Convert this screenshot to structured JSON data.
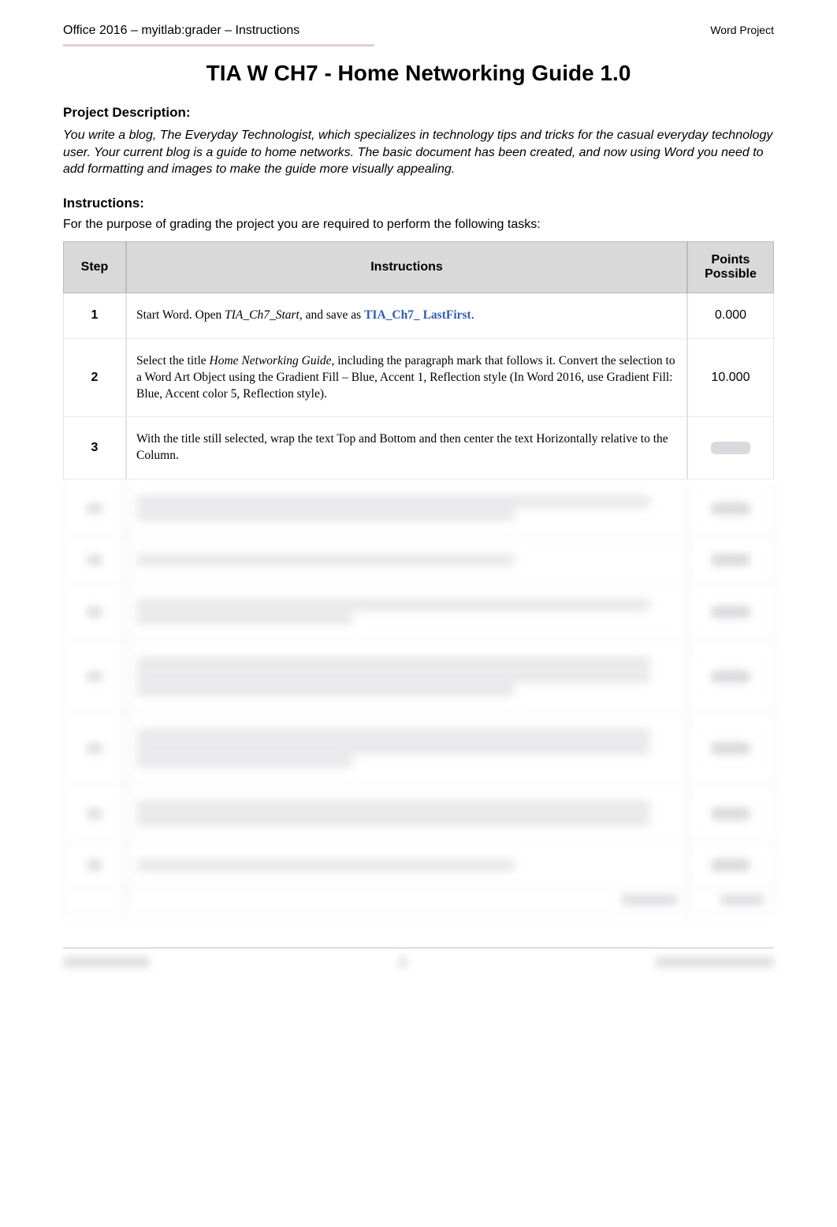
{
  "header": {
    "left": "Office 2016 – myitlab:grader – Instructions",
    "right": "Word Project"
  },
  "title": "TIA W CH7 - Home Networking Guide 1.0",
  "sections": {
    "description_heading": "Project Description:",
    "description_text": "You write a blog, The Everyday Technologist, which specializes in technology tips and tricks for the casual everyday technology user. Your current blog is a guide to home networks. The basic document has been created, and now using Word you need to add formatting and images to make the guide more visually appealing.",
    "instructions_heading": "Instructions:",
    "instructions_intro": "For the purpose of grading the project you are required to perform the following tasks:"
  },
  "table": {
    "headers": {
      "step": "Step",
      "instructions": "Instructions",
      "points": "Points Possible"
    },
    "rows": [
      {
        "step": "1",
        "instruction_pre": "Start Word. Open ",
        "instruction_file": "TIA_Ch7_Start",
        "instruction_mid": ", and save as ",
        "instruction_link": "TIA_Ch7_ LastFirst",
        "instruction_post": ".",
        "points": "0.000"
      },
      {
        "step": "2",
        "instruction_pre": "Select the title ",
        "instruction_em": "Home Networking Guide",
        "instruction_post": ", including the paragraph mark that follows it. Convert the selection to a Word Art Object using the Gradient Fill – Blue, Accent 1, Reflection style (In Word 2016, use Gradient Fill: Blue, Accent color 5, Reflection style).",
        "points": "10.000"
      },
      {
        "step": "3",
        "instruction": "With the title still selected, wrap the text Top and Bottom and then center the text Horizontally relative to the Column.",
        "points": ""
      }
    ]
  }
}
